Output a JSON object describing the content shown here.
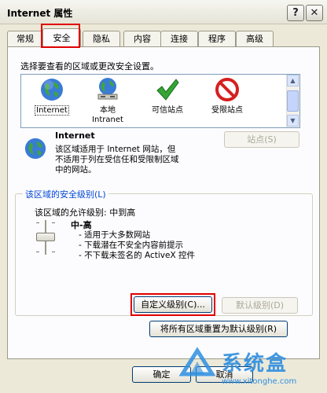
{
  "window": {
    "title": "Internet 属性",
    "help_btn": "?",
    "close_btn": "✕"
  },
  "tabs": [
    {
      "label": "常规"
    },
    {
      "label": "安全"
    },
    {
      "label": "隐私"
    },
    {
      "label": "内容"
    },
    {
      "label": "连接"
    },
    {
      "label": "程序"
    },
    {
      "label": "高级"
    }
  ],
  "security": {
    "prompt": "选择要查看的区域或更改安全设置。",
    "zones": [
      {
        "label": "Internet",
        "icon": "globe-icon"
      },
      {
        "label": "本地\nIntranet",
        "icon": "local-intranet-icon"
      },
      {
        "label": "可信站点",
        "icon": "checkmark-icon"
      },
      {
        "label": "受限站点",
        "icon": "restricted-icon"
      }
    ],
    "selected_zone": {
      "title": "Internet",
      "description": "该区域适用于 Internet 网站，但\n不适用于列在受信任和受限制区域\n中的网站。"
    },
    "sites_button": "站点(S)",
    "level_group": {
      "label": "该区域的安全级别(L)",
      "allowed": "该区域的允许级别: 中到高",
      "level_name": "中-高",
      "bullets": [
        "- 适用于大多数网站",
        "- 下载潜在不安全内容前提示",
        "- 不下载未签名的 ActiveX 控件"
      ],
      "custom_button": "自定义级别(C)...",
      "default_button": "默认级别(D)"
    },
    "reset_all_button": "将所有区域重置为默认级别(R)"
  },
  "footer": {
    "ok": "确定",
    "cancel": "取消"
  },
  "watermark": {
    "name": "系统盒",
    "url": "www.xitonghe.com"
  }
}
